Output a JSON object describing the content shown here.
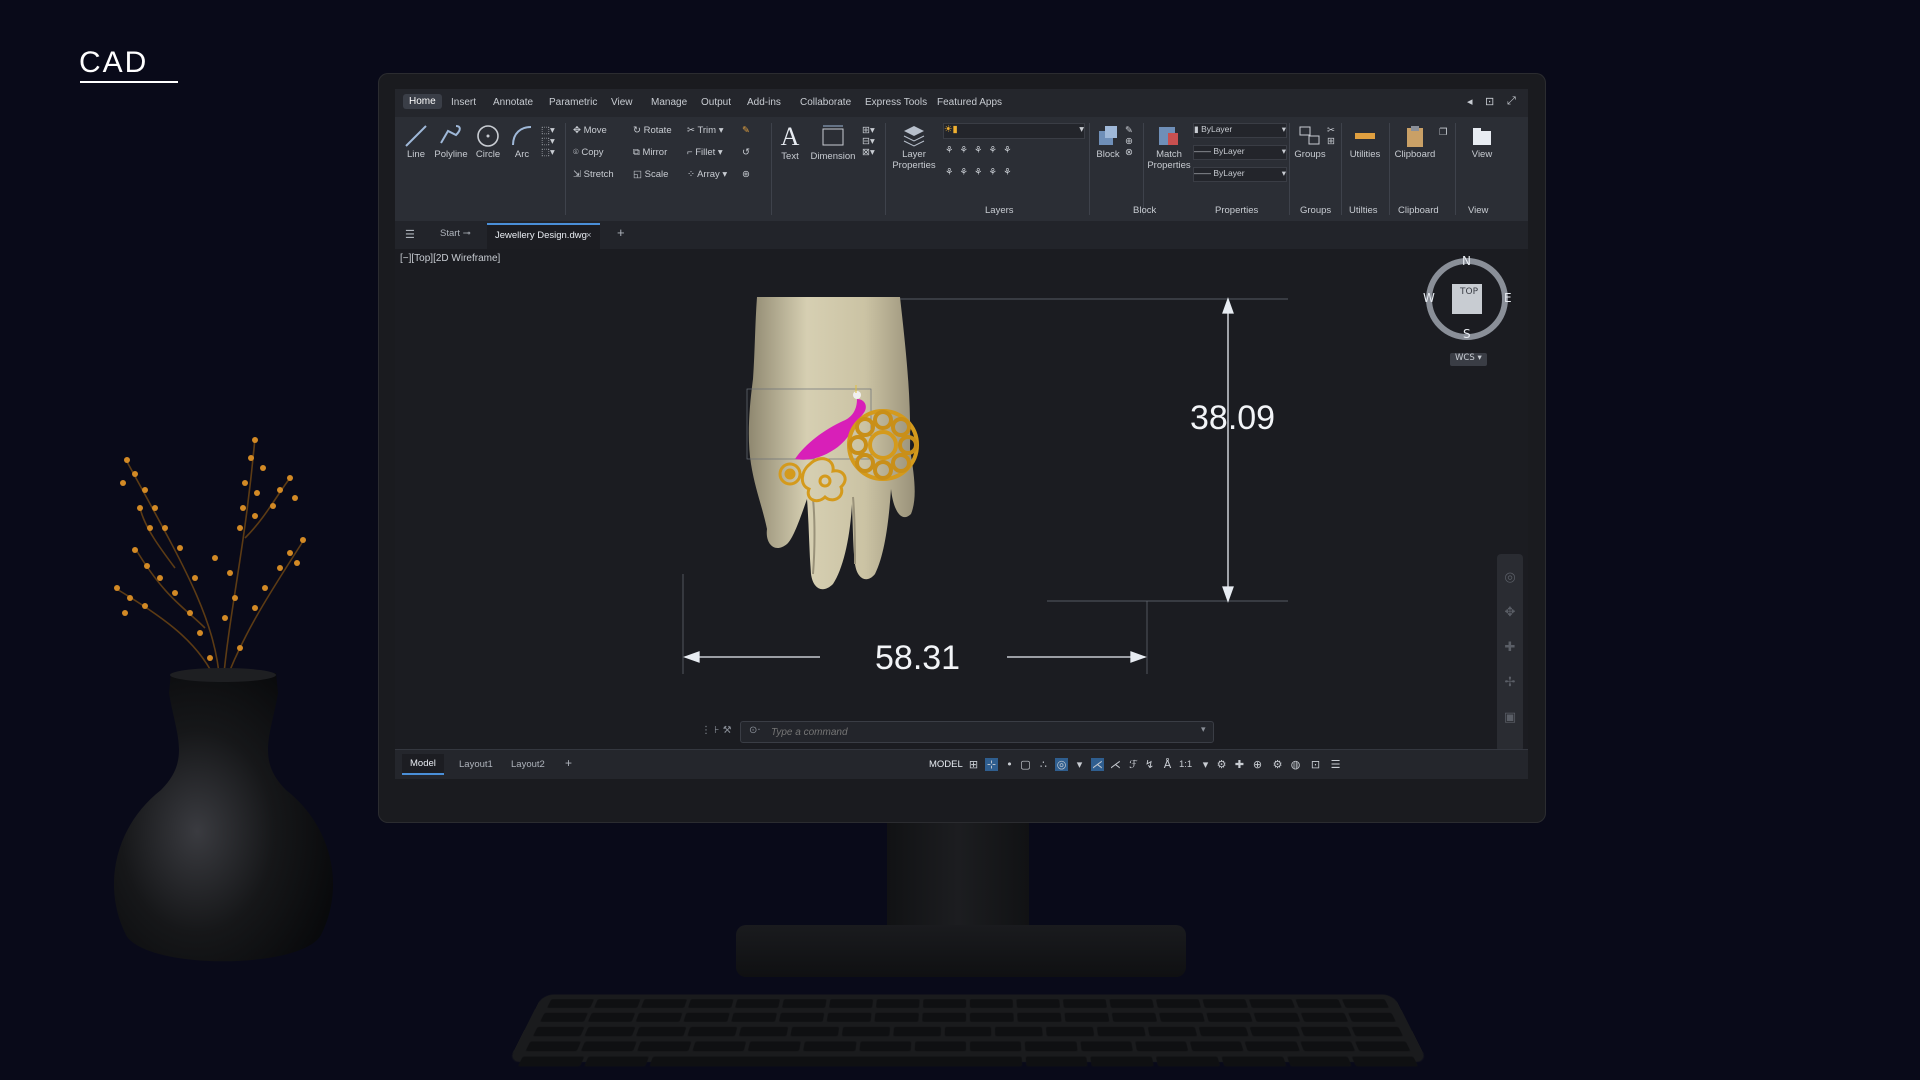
{
  "brand": {
    "text": "CAD"
  },
  "app": {
    "menu_tabs": [
      "Home",
      "Insert",
      "Annotate",
      "Parametric",
      "View",
      "Manage",
      "Output",
      "Add-ins",
      "Collaborate",
      "Express Tools",
      "Featured Apps"
    ],
    "ribbon": {
      "draw": {
        "line": "Line",
        "polyline": "Polyline",
        "circle": "Circle",
        "arc": "Arc"
      },
      "modify": {
        "move": "Move",
        "rotate": "Rotate",
        "trim": "Trim",
        "copy": "Copy",
        "mirror": "Mirror",
        "fillet": "Fillet",
        "stretch": "Stretch",
        "scale": "Scale",
        "array": "Array"
      },
      "annotation": {
        "text": "Text",
        "dimension": "Dimension"
      },
      "layers": {
        "layer_properties": "Layer Properties",
        "label": "Layers"
      },
      "block": {
        "block": "Block",
        "label": "Block"
      },
      "properties": {
        "match_properties": "Match Properties",
        "bylayer_1": "ByLayer",
        "bylayer_2": "ByLayer",
        "bylayer_3": "ByLayer",
        "label": "Properties"
      },
      "groups": {
        "groups": "Groups",
        "label": "Groups"
      },
      "utilities": {
        "utilities": "Utilities",
        "label": "Utilties"
      },
      "clipboard": {
        "clipboard": "Clipboard",
        "label": "Clipboard"
      },
      "view": {
        "view": "View",
        "label": "View"
      }
    },
    "file_tabs": {
      "start": "Start",
      "document": "Jewellery Design.dwg"
    },
    "viewport_label": "[−][Top][2D Wireframe]",
    "dimensions": {
      "height": "38.09",
      "width": "58.31"
    },
    "viewcube": {
      "n": "N",
      "s": "S",
      "e": "E",
      "w": "W",
      "face": "TOP",
      "wcs": "WCS"
    },
    "command": {
      "placeholder": "Type a command"
    },
    "status": {
      "model_tab": "Model",
      "layout1": "Layout1",
      "layout2": "Layout2",
      "model_space": "MODEL",
      "scale": "1:1"
    },
    "colors": {
      "accent": "#4a8fd8",
      "ring_gold": "#d49a1c",
      "ring_pink": "#d81fb8",
      "hand": "#cfc6a6"
    }
  }
}
